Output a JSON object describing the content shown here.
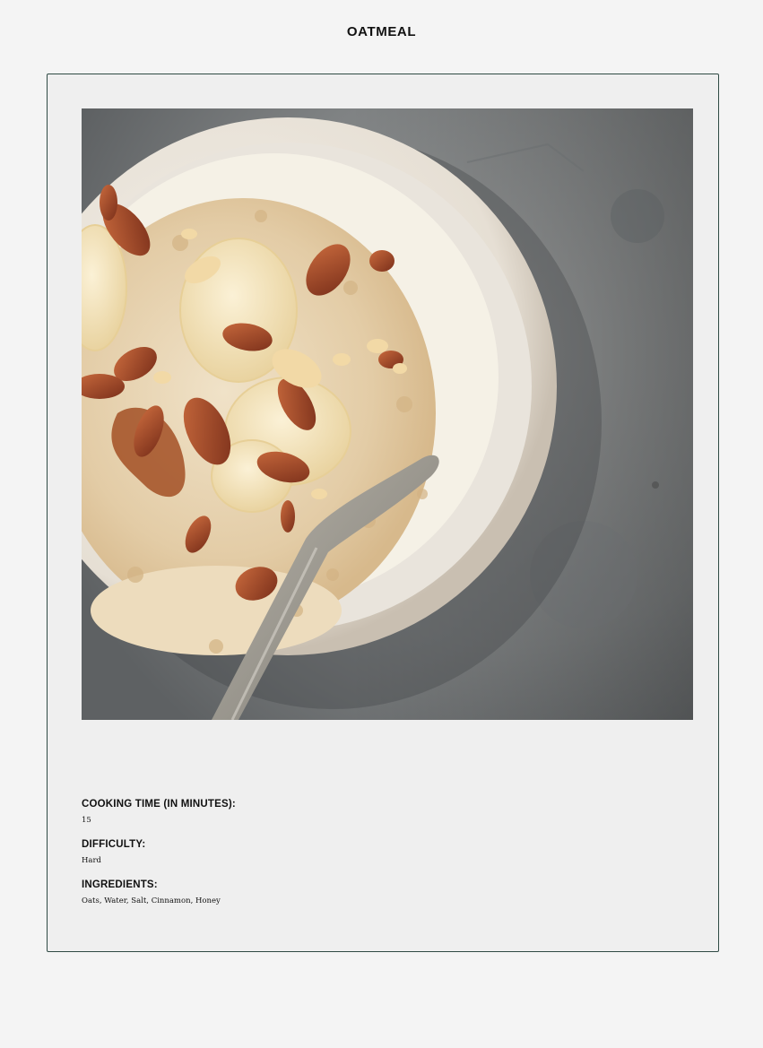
{
  "recipe": {
    "title": "OATMEAL",
    "image_alt": "Bowl of oatmeal topped with banana slices, almonds and honey",
    "details": [
      {
        "label": "COOKING TIME (IN MINUTES):",
        "value": "15"
      },
      {
        "label": "DIFFICULTY:",
        "value": "Hard"
      },
      {
        "label": "INGREDIENTS:",
        "value": "Oats, Water, Salt, Cinnamon, Honey"
      }
    ]
  },
  "colors": {
    "page_background": "#f4f4f4",
    "card_background": "#efefef",
    "card_border": "#2f4a44",
    "text": "#111111"
  }
}
